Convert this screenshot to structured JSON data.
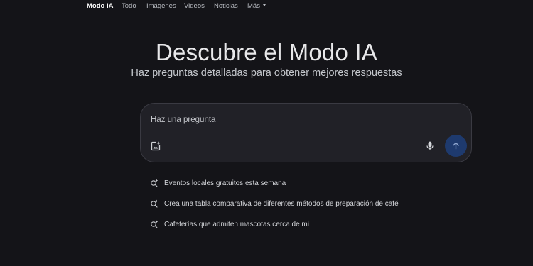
{
  "tabs": [
    {
      "label": "Modo IA",
      "active": true
    },
    {
      "label": "Todo",
      "active": false
    },
    {
      "label": "Imágenes",
      "active": false
    },
    {
      "label": "Videos",
      "active": false
    },
    {
      "label": "Noticias",
      "active": false
    },
    {
      "label": "Más",
      "active": false,
      "dropdown": true
    }
  ],
  "hero": {
    "title": "Descubre el Modo IA",
    "subtitle": "Haz preguntas detalladas para obtener mejores respuestas"
  },
  "search": {
    "placeholder": "Haz una pregunta",
    "value": "",
    "image_icon": "add-image-icon",
    "mic_icon": "microphone-icon",
    "send_icon": "arrow-up-icon"
  },
  "suggestions": [
    {
      "label": "Eventos locales gratuitos esta semana",
      "icon": "sparkle-search-icon"
    },
    {
      "label": "Crea una tabla comparativa de diferentes métodos de preparación de café",
      "icon": "sparkle-search-icon"
    },
    {
      "label": "Cafeterías que admiten mascotas cerca de mi",
      "icon": "sparkle-search-icon"
    }
  ],
  "colors": {
    "background": "#141418",
    "search_box": "#212127",
    "send_button": "#1e3a6e",
    "text_primary": "#e8e8ea"
  }
}
